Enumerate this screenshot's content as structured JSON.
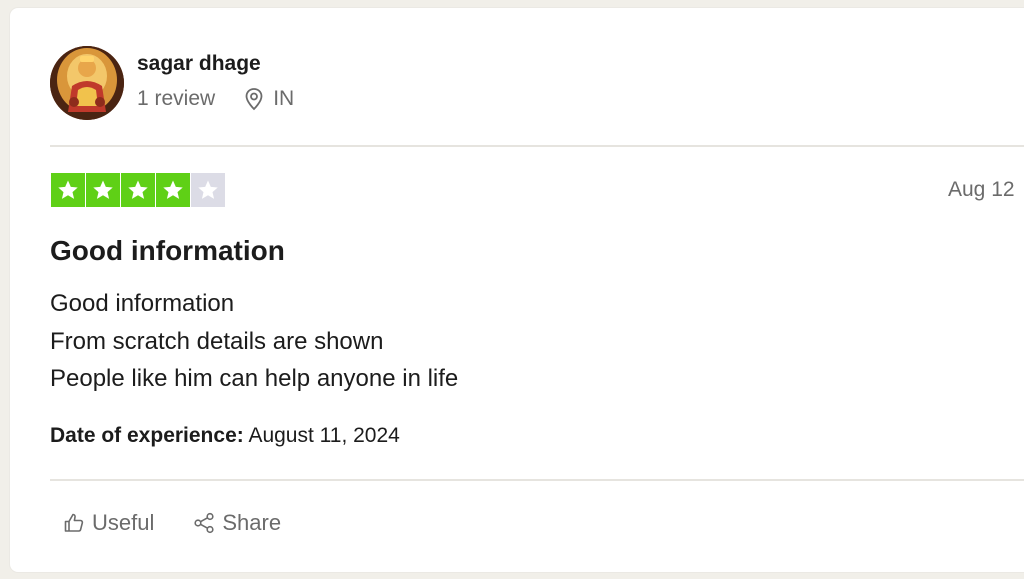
{
  "reviewer": {
    "name": "sagar dhage",
    "review_count": "1 review",
    "country": "IN",
    "avatar_icon": "deity-portrait-avatar"
  },
  "rating": {
    "stars_filled": 4,
    "stars_total": 5,
    "color_on": "#5fd016",
    "color_off": "#dcdce6"
  },
  "review": {
    "date": "Aug 12",
    "title": "Good information",
    "body_lines": [
      "Good information",
      "From scratch details are shown",
      "People like him can help anyone in life"
    ],
    "experience_label": "Date of experience:",
    "experience_date": "August 11, 2024"
  },
  "actions": {
    "useful_label": "Useful",
    "share_label": "Share"
  }
}
